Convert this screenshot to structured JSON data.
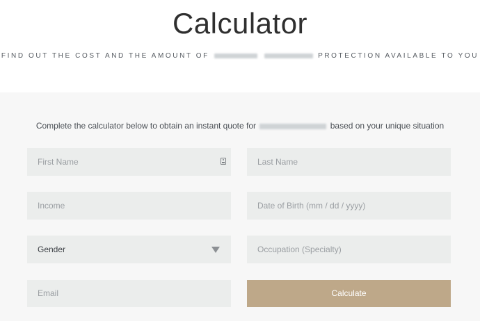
{
  "header": {
    "title": "Calculator",
    "subtitle_prefix": "FIND OUT THE COST AND THE AMOUNT OF",
    "subtitle_suffix": "PROTECTION AVAILABLE TO YOU"
  },
  "form": {
    "intro_prefix": "Complete the calculator below to obtain an instant quote for",
    "intro_suffix": "based on your unique situation",
    "first_name_placeholder": "First Name",
    "last_name_placeholder": "Last Name",
    "income_placeholder": "Income",
    "dob_placeholder": "Date of Birth (mm / dd / yyyy)",
    "gender_selected": "Gender",
    "occupation_placeholder": "Occupation (Specialty)",
    "email_placeholder": "Email",
    "calculate_label": "Calculate"
  },
  "icons": {
    "first_name": "contact-card-icon",
    "gender": "caret-down-icon"
  },
  "colors": {
    "button": "#bea889",
    "field_background": "#ebedec",
    "panel_background": "#f7f7f7"
  }
}
